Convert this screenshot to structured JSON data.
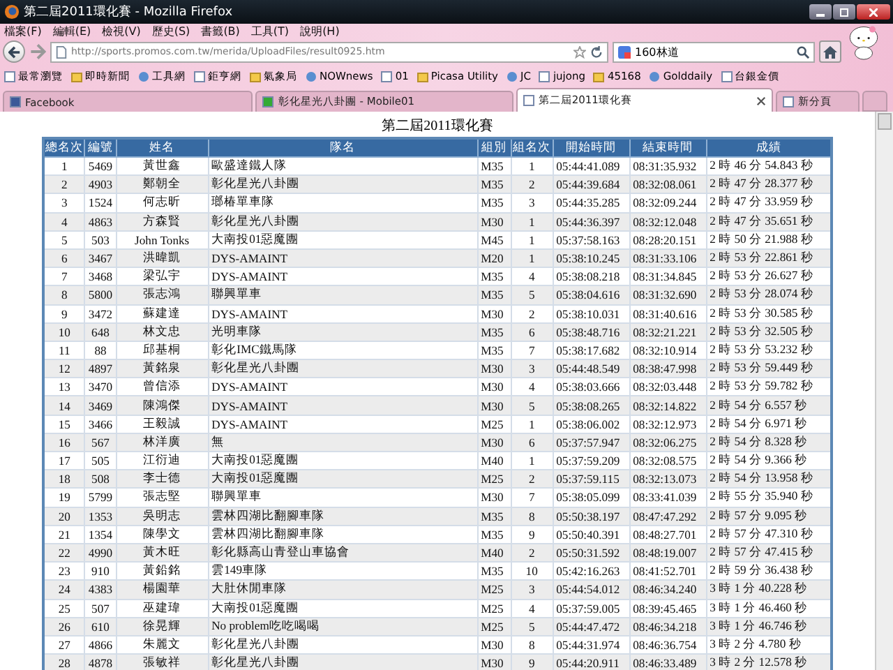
{
  "window": {
    "title": "第二屆2011環化賽 - Mozilla Firefox"
  },
  "menu": [
    "檔案(F)",
    "編輯(E)",
    "檢視(V)",
    "歷史(S)",
    "書籤(B)",
    "工具(T)",
    "說明(H)"
  ],
  "address": {
    "value": "http://sports.promos.com.tw/merida/UploadFiles/result0925.htm"
  },
  "search": {
    "value": "160林道"
  },
  "bookmarks": [
    "最常瀏覽",
    "即時新聞",
    "工具網",
    "鉅亨網",
    "氣象局",
    "NOWnews",
    "01",
    "Picasa Utility",
    "JC",
    "jujong",
    "45168",
    "Golddaily",
    "台銀金價"
  ],
  "tabs": [
    {
      "label": "Facebook",
      "selected": false
    },
    {
      "label": "彰化星光八卦團 - Mobile01",
      "selected": false
    },
    {
      "label": "第二屆2011環化賽",
      "selected": true
    },
    {
      "label": "新分頁",
      "selected": false
    }
  ],
  "page": {
    "title": "第二屆2011環化賽"
  },
  "table": {
    "columns": [
      "總名次",
      "編號",
      "姓名",
      "隊名",
      "組別",
      "組名次",
      "開始時間",
      "結束時間",
      "成績"
    ],
    "rows": [
      [
        "1",
        "5469",
        "黃世鑫",
        "歐盛達鐵人隊",
        "M35",
        "1",
        "05:44:41.089",
        "08:31:35.932",
        "2 時 46 分 54.843 秒"
      ],
      [
        "2",
        "4903",
        "鄭朝全",
        "彰化星光八卦團",
        "M35",
        "2",
        "05:44:39.684",
        "08:32:08.061",
        "2 時 47 分 28.377 秒"
      ],
      [
        "3",
        "1524",
        "何志昕",
        "瑯椿單車隊",
        "M35",
        "3",
        "05:44:35.285",
        "08:32:09.244",
        "2 時 47 分 33.959 秒"
      ],
      [
        "4",
        "4863",
        "方森賢",
        "彰化星光八卦團",
        "M30",
        "1",
        "05:44:36.397",
        "08:32:12.048",
        "2 時 47 分 35.651 秒"
      ],
      [
        "5",
        "503",
        "John Tonks",
        "大南投01惡魔團",
        "M45",
        "1",
        "05:37:58.163",
        "08:28:20.151",
        "2 時 50 分 21.988 秒"
      ],
      [
        "6",
        "3467",
        "洪暐凱",
        "DYS-AMAINT",
        "M20",
        "1",
        "05:38:10.245",
        "08:31:33.106",
        "2 時 53 分 22.861 秒"
      ],
      [
        "7",
        "3468",
        "梁弘宇",
        "DYS-AMAINT",
        "M35",
        "4",
        "05:38:08.218",
        "08:31:34.845",
        "2 時 53 分 26.627 秒"
      ],
      [
        "8",
        "5800",
        "張志鴻",
        "聯興單車",
        "M35",
        "5",
        "05:38:04.616",
        "08:31:32.690",
        "2 時 53 分 28.074 秒"
      ],
      [
        "9",
        "3472",
        "蘇建達",
        "DYS-AMAINT",
        "M30",
        "2",
        "05:38:10.031",
        "08:31:40.616",
        "2 時 53 分 30.585 秒"
      ],
      [
        "10",
        "648",
        "林文忠",
        "光明車隊",
        "M35",
        "6",
        "05:38:48.716",
        "08:32:21.221",
        "2 時 53 分 32.505 秒"
      ],
      [
        "11",
        "88",
        "邱基桐",
        "彰化IMC鐵馬隊",
        "M35",
        "7",
        "05:38:17.682",
        "08:32:10.914",
        "2 時 53 分 53.232 秒"
      ],
      [
        "12",
        "4897",
        "黃銘泉",
        "彰化星光八卦團",
        "M30",
        "3",
        "05:44:48.549",
        "08:38:47.998",
        "2 時 53 分 59.449 秒"
      ],
      [
        "13",
        "3470",
        "曾信添",
        "DYS-AMAINT",
        "M30",
        "4",
        "05:38:03.666",
        "08:32:03.448",
        "2 時 53 分 59.782 秒"
      ],
      [
        "14",
        "3469",
        "陳鴻傑",
        "DYS-AMAINT",
        "M30",
        "5",
        "05:38:08.265",
        "08:32:14.822",
        "2 時 54 分 6.557 秒"
      ],
      [
        "15",
        "3466",
        "王毅誠",
        "DYS-AMAINT",
        "M25",
        "1",
        "05:38:06.002",
        "08:32:12.973",
        "2 時 54 分 6.971 秒"
      ],
      [
        "16",
        "567",
        "林洋廣",
        "無",
        "M30",
        "6",
        "05:37:57.947",
        "08:32:06.275",
        "2 時 54 分 8.328 秒"
      ],
      [
        "17",
        "505",
        "江衍迪",
        "大南投01惡魔團",
        "M40",
        "1",
        "05:37:59.209",
        "08:32:08.575",
        "2 時 54 分 9.366 秒"
      ],
      [
        "18",
        "508",
        "李士德",
        "大南投01惡魔團",
        "M25",
        "2",
        "05:37:59.115",
        "08:32:13.073",
        "2 時 54 分 13.958 秒"
      ],
      [
        "19",
        "5799",
        "張志堅",
        "聯興單車",
        "M30",
        "7",
        "05:38:05.099",
        "08:33:41.039",
        "2 時 55 分 35.940 秒"
      ],
      [
        "20",
        "1353",
        "吳明志",
        "雲林四湖比翻腳車隊",
        "M35",
        "8",
        "05:50:38.197",
        "08:47:47.292",
        "2 時 57 分 9.095 秒"
      ],
      [
        "21",
        "1354",
        "陳學文",
        "雲林四湖比翻腳車隊",
        "M35",
        "9",
        "05:50:40.391",
        "08:48:27.701",
        "2 時 57 分 47.310 秒"
      ],
      [
        "22",
        "4990",
        "黃木旺",
        "彰化縣高山青登山車協會",
        "M40",
        "2",
        "05:50:31.592",
        "08:48:19.007",
        "2 時 57 分 47.415 秒"
      ],
      [
        "23",
        "910",
        "黃鉛銘",
        "雲149車隊",
        "M35",
        "10",
        "05:42:16.263",
        "08:41:52.701",
        "2 時 59 分 36.438 秒"
      ],
      [
        "24",
        "4383",
        "楊園華",
        "大肚休閒車隊",
        "M25",
        "3",
        "05:44:54.012",
        "08:46:34.240",
        "3 時 1 分 40.228 秒"
      ],
      [
        "25",
        "507",
        "巫建瑋",
        "大南投01惡魔團",
        "M25",
        "4",
        "05:37:59.005",
        "08:39:45.465",
        "3 時 1 分 46.460 秒"
      ],
      [
        "26",
        "610",
        "徐晃輝",
        "No problem吃吃喝喝",
        "M25",
        "5",
        "05:44:47.472",
        "08:46:34.218",
        "3 時 1 分 46.746 秒"
      ],
      [
        "27",
        "4866",
        "朱麗文",
        "彰化星光八卦團",
        "M30",
        "8",
        "05:44:31.974",
        "08:46:36.754",
        "3 時 2 分 4.780 秒"
      ],
      [
        "28",
        "4878",
        "張敏祥",
        "彰化星光八卦團",
        "M30",
        "9",
        "05:44:20.911",
        "08:46:33.489",
        "3 時 2 分 12.578 秒"
      ]
    ]
  }
}
